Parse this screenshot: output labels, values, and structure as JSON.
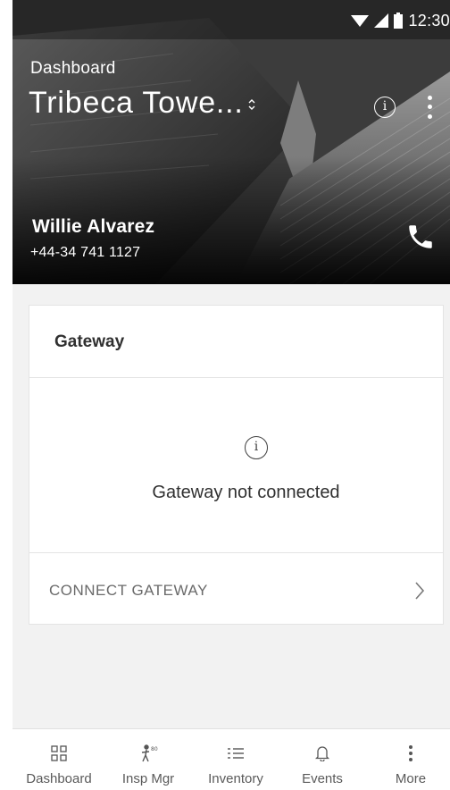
{
  "status_bar": {
    "time": "12:30",
    "icons": [
      "wifi-icon",
      "signal-icon",
      "battery-icon"
    ]
  },
  "header": {
    "breadcrumb": "Dashboard",
    "site_name": "Tribeca Towe...",
    "contact_name": "Willie Alvarez",
    "contact_phone": "+44-34 741 1127",
    "icons": [
      "info-icon",
      "more-vert-icon",
      "phone-icon",
      "site-switcher-icon"
    ]
  },
  "gateway_card": {
    "title": "Gateway",
    "status_icon": "info-icon",
    "message": "Gateway not connected",
    "action_label": "CONNECT GATEWAY",
    "action_icon": "chevron-right-icon"
  },
  "bottom_nav": {
    "items": [
      {
        "label": "Dashboard",
        "icon": "grid-icon"
      },
      {
        "label": "Insp Mgr",
        "icon": "inspector-icon"
      },
      {
        "label": "Inventory",
        "icon": "list-icon"
      },
      {
        "label": "Events",
        "icon": "bell-icon"
      },
      {
        "label": "More",
        "icon": "more-vert-icon"
      }
    ]
  },
  "colors": {
    "text_primary": "#303030",
    "text_secondary": "#6a6a6a",
    "background": "#f2f2f2",
    "card": "#ffffff"
  }
}
